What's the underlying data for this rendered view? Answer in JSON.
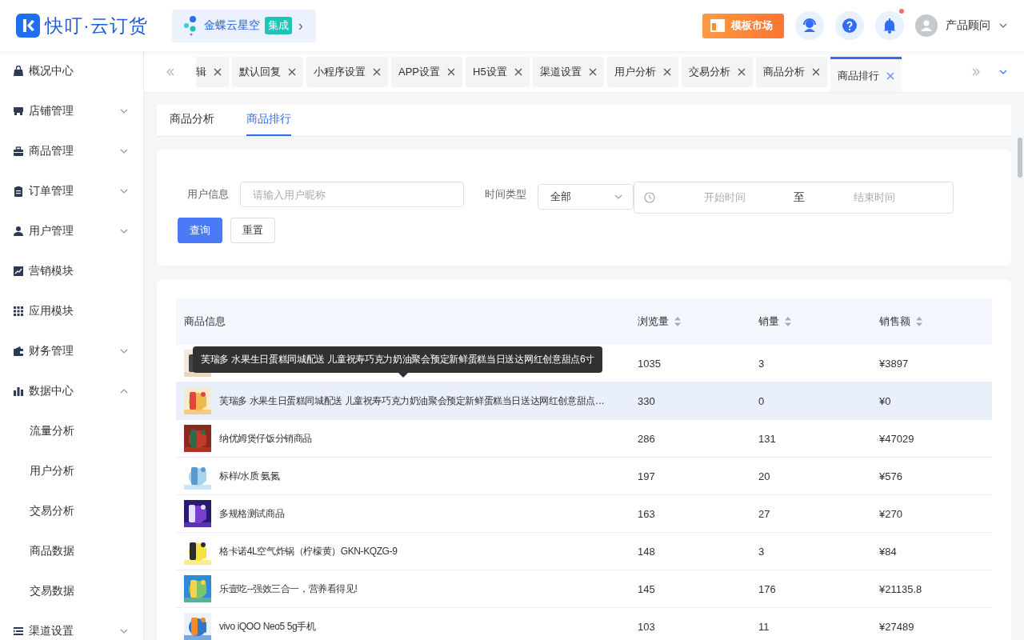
{
  "header": {
    "logo_text": "快叮·云订货",
    "integration": {
      "name": "金蝶云星空",
      "badge": "集成",
      "arrow": "›"
    },
    "market_button": "模板市场",
    "notification_dot": true,
    "user": "产品顾问"
  },
  "sidebar": {
    "items": [
      {
        "label": "概况中心",
        "kind": "link"
      },
      {
        "label": "店铺管理",
        "kind": "group",
        "expanded": false
      },
      {
        "label": "商品管理",
        "kind": "group",
        "expanded": false
      },
      {
        "label": "订单管理",
        "kind": "group",
        "expanded": false
      },
      {
        "label": "用户管理",
        "kind": "group",
        "expanded": false
      },
      {
        "label": "营销模块",
        "kind": "link"
      },
      {
        "label": "应用模块",
        "kind": "link"
      },
      {
        "label": "财务管理",
        "kind": "group",
        "expanded": false
      },
      {
        "label": "数据中心",
        "kind": "group",
        "expanded": true,
        "children": [
          {
            "label": "流量分析"
          },
          {
            "label": "用户分析"
          },
          {
            "label": "交易分析"
          },
          {
            "label": "商品数据"
          },
          {
            "label": "交易数据"
          }
        ]
      },
      {
        "label": "渠道设置",
        "kind": "group",
        "expanded": false
      }
    ]
  },
  "page_tabs": [
    {
      "label": "辑",
      "selected": false
    },
    {
      "label": "默认回复",
      "selected": false
    },
    {
      "label": "小程序设置",
      "selected": false
    },
    {
      "label": "APP设置",
      "selected": false
    },
    {
      "label": "H5设置",
      "selected": false
    },
    {
      "label": "渠道设置",
      "selected": false
    },
    {
      "label": "用户分析",
      "selected": false
    },
    {
      "label": "交易分析",
      "selected": false
    },
    {
      "label": "商品分析",
      "selected": false
    },
    {
      "label": "商品排行",
      "selected": true
    }
  ],
  "sub_tabs": [
    {
      "label": "商品分析",
      "selected": false
    },
    {
      "label": "商品排行",
      "selected": true
    }
  ],
  "filters": {
    "user_field": {
      "label": "用户信息",
      "placeholder": "请输入用户昵称"
    },
    "time_type": {
      "label": "时间类型",
      "value": "全部"
    },
    "date_range": {
      "start_placeholder": "开始时间",
      "separator": "至",
      "end_placeholder": "结束时间"
    },
    "buttons": [
      {
        "label": "查询",
        "kind": "primary"
      },
      {
        "label": "重置",
        "kind": "plain"
      }
    ]
  },
  "table": {
    "columns": [
      {
        "label": "商品信息",
        "kind": "plain"
      },
      {
        "label": "浏览量",
        "kind": "sortable"
      },
      {
        "label": "销量",
        "kind": "sortable"
      },
      {
        "label": "销售额",
        "kind": "sortable"
      }
    ],
    "rows": [
      {
        "views": "1035",
        "sales": "3",
        "amount": "¥3897",
        "highlighted": false
      },
      {
        "name": "芙瑞多 水果生日蛋糕同城配送 儿童祝寿巧克力奶油聚会预定新鲜蛋糕当日送达网红创意甜点…",
        "views": "330",
        "sales": "0",
        "amount": "¥0",
        "highlighted": true
      },
      {
        "name": "纳优姆煲仔饭分销商品",
        "views": "286",
        "sales": "131",
        "amount": "¥47029",
        "highlighted": false
      },
      {
        "name": "标样/水质 氨氮",
        "views": "197",
        "sales": "20",
        "amount": "¥576",
        "highlighted": false
      },
      {
        "name": "多规格测试商品",
        "views": "163",
        "sales": "27",
        "amount": "¥270",
        "highlighted": false
      },
      {
        "name": "格卡诺4L空气炸锅（柠檬黄）GKN-KQZG-9",
        "views": "148",
        "sales": "3",
        "amount": "¥84",
        "highlighted": false
      },
      {
        "name": "乐壹吃--强效三合一，营养看得见!",
        "views": "145",
        "sales": "176",
        "amount": "¥21135.8",
        "highlighted": false
      },
      {
        "name": "vivo iQOO Neo5 5g手机",
        "views": "103",
        "sales": "11",
        "amount": "¥27489",
        "highlighted": false
      }
    ],
    "tooltip": "芙瑞多 水果生日蛋糕同城配送 儿童祝寿巧克力奶油聚会预定新鲜蛋糕当日送达网红创意甜点6寸"
  }
}
